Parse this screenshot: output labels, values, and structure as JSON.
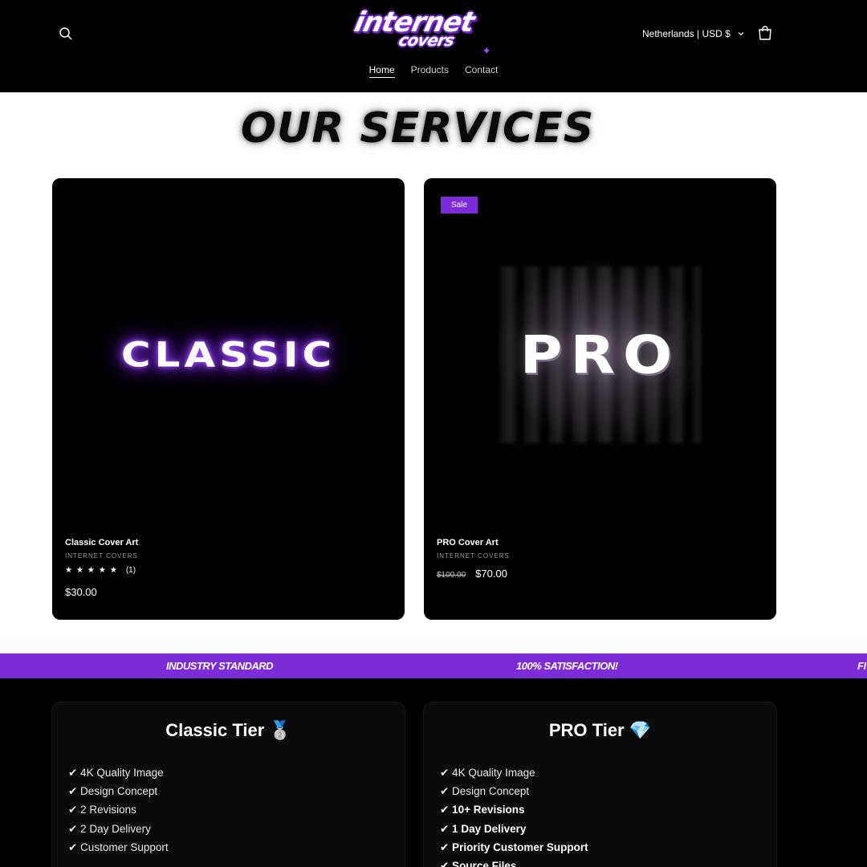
{
  "header": {
    "logo_line1": "internet",
    "logo_line2": "covers",
    "region_label": "Netherlands | USD $",
    "nav": [
      {
        "label": "Home",
        "active": true
      },
      {
        "label": "Products",
        "active": false
      },
      {
        "label": "Contact",
        "active": false
      }
    ],
    "icons": {
      "search": "search-icon",
      "cart": "cart-icon",
      "chevron": "chevron-down-icon"
    }
  },
  "services": {
    "title": "OUR SERVICES",
    "products": [
      {
        "art_text": "CLASSIC",
        "name": "Classic Cover Art",
        "vendor": "INTERNET COVERS",
        "rating_stars": "★★★★★",
        "rating_count": "(1)",
        "price": "$30.00"
      },
      {
        "badge": "Sale",
        "art_text": "PRO",
        "name": "PRO Cover Art",
        "vendor": "INTERNET COVERS",
        "price_old": "$100.00",
        "price_new": "$70.00"
      }
    ]
  },
  "marquee": [
    "INDUSTRY STANDARD",
    "100% SATISFACTION!",
    "FI"
  ],
  "tiers": [
    {
      "title": "Classic Tier 🥈",
      "features": [
        "✔ 4K Quality Image",
        "✔ Design Concept",
        "✔ 2 Revisions",
        "✔ 2 Day Delivery",
        "✔ Customer Support"
      ]
    },
    {
      "title": "PRO Tier 💎",
      "features": [
        "✔ 4K Quality Image",
        "✔ Design Concept",
        "✔ 10+ Revisions",
        "✔ 1 Day Delivery",
        "✔ Priority Customer Support",
        "✔ Source Files"
      ]
    }
  ],
  "colors": {
    "accent": "#7b2cd8",
    "background": "#000000",
    "page": "#ffffff"
  }
}
